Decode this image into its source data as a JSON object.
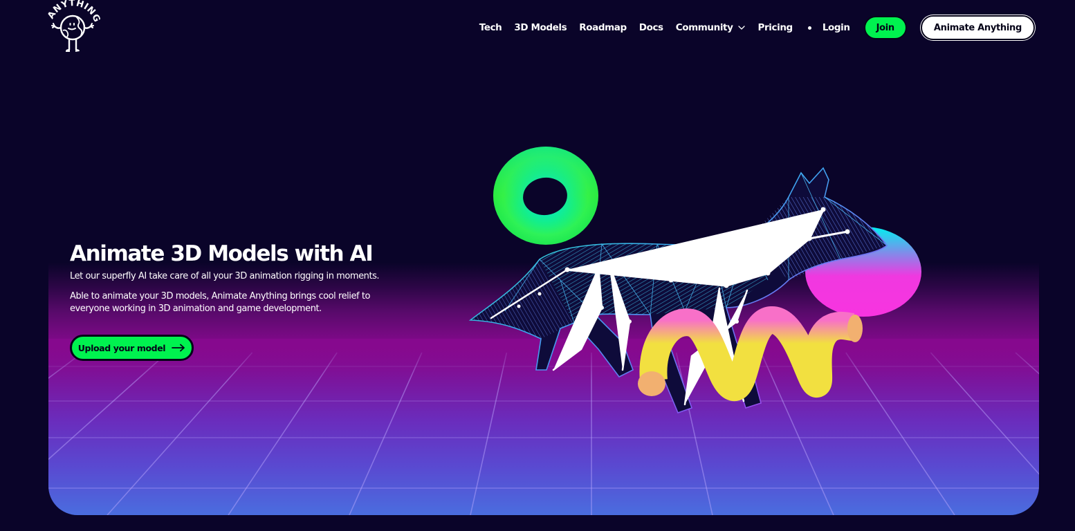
{
  "brand": {
    "logo_text": "ANYTHING",
    "logo_icon": "smiling-globe-mascot-icon"
  },
  "nav": {
    "links": [
      {
        "label": "Tech"
      },
      {
        "label": "3D Models"
      },
      {
        "label": "Roadmap"
      },
      {
        "label": "Docs"
      },
      {
        "label": "Community",
        "icon": "chevron-down-icon"
      },
      {
        "label": "Pricing"
      }
    ],
    "separator_icon": "dot-icon",
    "login_label": "Login",
    "join_label": "Join",
    "cta_label": "Animate Anything"
  },
  "hero": {
    "title": "Animate 3D Models with AI",
    "subtitle": "Let our superfly AI take care of all your 3D animation rigging in moments.",
    "body": "Able to animate your 3D models, Animate Anything brings cool relief to everyone working in 3D animation and game development.",
    "upload_label": "Upload your model",
    "upload_icon": "arrow-right-icon",
    "art": {
      "objects": [
        "green-torus",
        "wireframe-rigged-fox",
        "pink-cyan-sphere",
        "yellow-pink-spiral-tube",
        "perspective-grid-floor"
      ]
    }
  },
  "colors": {
    "background": "#0a0429",
    "accent_green": "#00f24f",
    "button_text": "#050318",
    "gradient_magenta": "#86098e",
    "gradient_purple": "#6a2dbd",
    "gradient_blue": "#4a6ddf",
    "text": "#ffffff"
  }
}
